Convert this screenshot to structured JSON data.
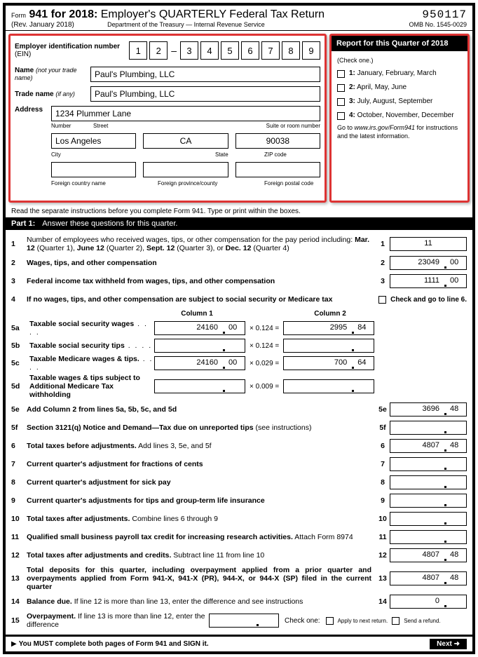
{
  "header": {
    "form_label": "Form",
    "form_no": "941 for 2018:",
    "title": "Employer's QUARTERLY Federal Tax Return",
    "rev": "(Rev. January 2018)",
    "dept": "Department of the Treasury — Internal Revenue Service",
    "seq": "950117",
    "omb": "OMB No. 1545-0029"
  },
  "ein": {
    "label": "Employer identification number",
    "abbr": "(EIN)",
    "d": [
      "1",
      "2",
      "3",
      "4",
      "5",
      "6",
      "7",
      "8",
      "9"
    ]
  },
  "name": {
    "label": "Name",
    "paren": "(not your trade name)",
    "value": "Paul's Plumbing, LLC"
  },
  "trade": {
    "label": "Trade name",
    "paren": "(if any)",
    "value": "Paul's Plumbing, LLC"
  },
  "address": {
    "label": "Address",
    "street": "1234 Plummer Lane",
    "number_lbl": "Number",
    "street_lbl": "Street",
    "suite_lbl": "Suite or room number",
    "city": "Los Angeles",
    "state": "CA",
    "zip": "90038",
    "city_lbl": "City",
    "state_lbl": "State",
    "zip_lbl": "ZIP code",
    "fc_lbl": "Foreign country name",
    "fp_lbl": "Foreign province/county",
    "fz_lbl": "Foreign postal code"
  },
  "quarter": {
    "title": "Report for this Quarter of 2018",
    "sub": "(Check one.)",
    "opts": [
      "1: January, February, March",
      "2: April, May, June",
      "3: July, August, September",
      "4: October, November, December"
    ],
    "note1": "Go to ",
    "note_url": "www.irs.gov/Form941",
    "note2": " for instructions and the latest information."
  },
  "instr": "Read the separate instructions before you complete Form 941. Type or print within the boxes.",
  "part1": {
    "num": "Part 1:",
    "title": "Answer these questions for this quarter."
  },
  "lines": {
    "l1": {
      "n": "1",
      "t": "Number of employees who received wages, tips, or other compensation for the pay period including: ",
      "tb": "Mar. 12",
      "t2": " (Quarter 1), ",
      "tb2": "June 12",
      "t3": " (Quarter 2), ",
      "tb3": "Sept. 12",
      "t4": " (Quarter 3), or ",
      "tb4": "Dec. 12",
      "t5": " (Quarter 4)",
      "bn": "1",
      "v": "11"
    },
    "l2": {
      "n": "2",
      "t": "Wages, tips, and other compensation",
      "bn": "2",
      "v": "23049",
      "c": "00"
    },
    "l3": {
      "n": "3",
      "t": "Federal income tax withheld from wages, tips, and other compensation",
      "bn": "3",
      "v": "1111",
      "c": "00"
    },
    "l4": {
      "n": "4",
      "t": "If no wages, tips, and other compensation are subject to social security or Medicare tax",
      "chk": "Check and go to line 6."
    },
    "colh": {
      "c1": "Column 1",
      "c2": "Column 2"
    },
    "l5a": {
      "n": "5a",
      "t": "Taxable social security wages",
      "v1": "24160",
      "c1": "00",
      "m": "× 0.124 =",
      "v2": "2995",
      "c2": "84"
    },
    "l5b": {
      "n": "5b",
      "t": "Taxable social security tips",
      "m": "× 0.124 ="
    },
    "l5c": {
      "n": "5c",
      "t": "Taxable Medicare wages & tips.",
      "v1": "24160",
      "c1": "00",
      "m": "× 0.029 =",
      "v2": "700",
      "c2": "64"
    },
    "l5d": {
      "n": "5d",
      "t": "Taxable wages & tips subject to Additional Medicare Tax withholding",
      "m": "× 0.009 ="
    },
    "l5e": {
      "n": "5e",
      "t": "Add Column 2 from lines 5a, 5b, 5c, and 5d",
      "bn": "5e",
      "v": "3696",
      "c": "48"
    },
    "l5f": {
      "n": "5f",
      "t": "Section 3121(q) Notice and Demand—Tax due on unreported tips",
      "p": "(see instructions)",
      "bn": "5f"
    },
    "l6": {
      "n": "6",
      "t": "Total taxes before adjustments.",
      "t2": " Add lines 3, 5e, and 5f",
      "bn": "6",
      "v": "4807",
      "c": "48"
    },
    "l7": {
      "n": "7",
      "t": "Current quarter's adjustment for fractions of cents",
      "bn": "7"
    },
    "l8": {
      "n": "8",
      "t": "Current quarter's adjustment for sick pay",
      "bn": "8"
    },
    "l9": {
      "n": "9",
      "t": "Current quarter's adjustments for tips and group-term life insurance",
      "bn": "9"
    },
    "l10": {
      "n": "10",
      "t": "Total taxes after adjustments.",
      "t2": " Combine lines 6 through 9",
      "bn": "10"
    },
    "l11": {
      "n": "11",
      "t": "Qualified small business payroll tax credit for increasing research activities.",
      "t2": " Attach Form 8974",
      "bn": "11"
    },
    "l12": {
      "n": "12",
      "t": "Total taxes after adjustments and credits.",
      "t2": " Subtract line 11 from line 10",
      "bn": "12",
      "v": "4807",
      "c": "48"
    },
    "l13": {
      "n": "13",
      "t": "Total deposits for this quarter, including overpayment applied from a prior quarter and overpayments applied from Form 941-X, 941-X (PR), 944-X, or 944-X (SP) filed in the current quarter",
      "bn": "13",
      "v": "4807",
      "c": "48"
    },
    "l14": {
      "n": "14",
      "t": "Balance due.",
      "t2": " If line 12 is more than line 13, enter the difference and see instructions",
      "bn": "14",
      "v": "0"
    },
    "l15": {
      "n": "15",
      "t": "Overpayment.",
      "t2": " If line 13 is more than line 12, enter the difference",
      "chk1": "Apply to next return.",
      "chk2": "Send a refund.",
      "co": "Check one:"
    }
  },
  "footer": {
    "must": "You MUST complete both pages of Form 941 and SIGN it.",
    "next": "Next ➜"
  }
}
